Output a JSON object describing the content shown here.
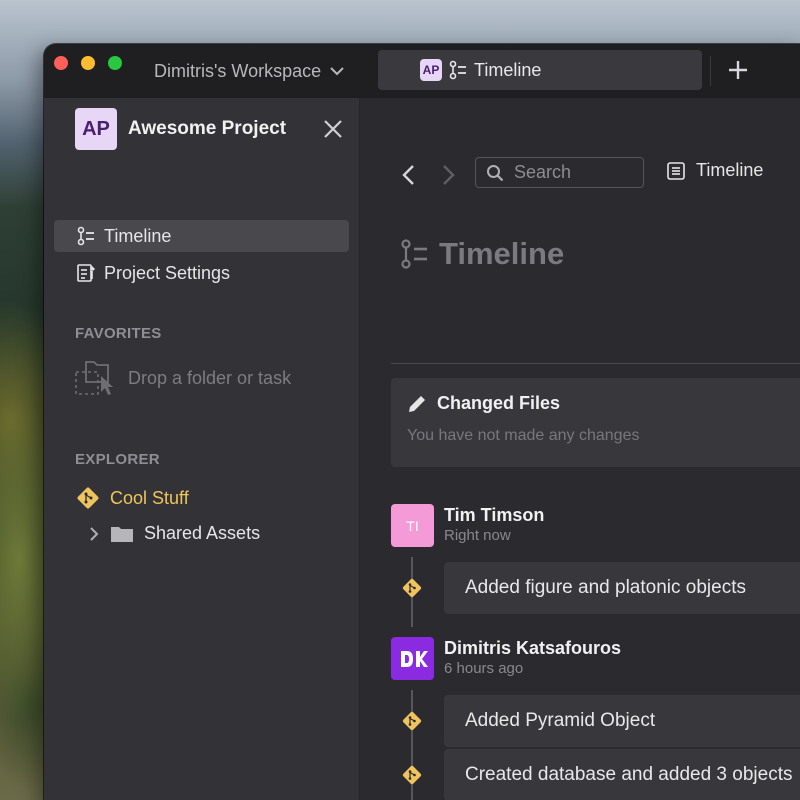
{
  "titlebar": {
    "workspace": "Dimitris's Workspace",
    "tab": {
      "badge": "AP",
      "label": "Timeline"
    }
  },
  "sidebar": {
    "project_badge": "AP",
    "project_name": "Awesome Project",
    "nav": [
      {
        "label": "Timeline",
        "icon": "timeline-icon",
        "active": true
      },
      {
        "label": "Project Settings",
        "icon": "settings-doc-icon",
        "active": false
      }
    ],
    "favorites_label": "FAVORITES",
    "drop_hint": "Drop a folder or task",
    "explorer_label": "EXPLORER",
    "explorer_items": [
      {
        "label": "Cool Stuff",
        "icon": "branch-diamond-icon"
      },
      {
        "label": "Shared Assets",
        "icon": "folder-icon"
      }
    ]
  },
  "main": {
    "search_placeholder": "Search",
    "breadcrumb": "Timeline",
    "page_title": "Timeline",
    "changed_files": {
      "title": "Changed Files",
      "subtitle": "You have not made any changes"
    },
    "entries": [
      {
        "initials": "TI",
        "author": "Tim Timson",
        "time": "Right now",
        "commits": [
          "Added figure and platonic objects"
        ]
      },
      {
        "initials": "DK",
        "author": "Dimitris Katsafouros",
        "time": "6 hours ago",
        "commits": [
          "Added Pyramid Object",
          "Created database and added 3 objects"
        ]
      }
    ]
  },
  "colors": {
    "accent_purple": "#8a2be2",
    "accent_gold": "#f0c45c",
    "avatar_pink": "#f49ad6",
    "badge_lilac": "#e7d6f5"
  }
}
